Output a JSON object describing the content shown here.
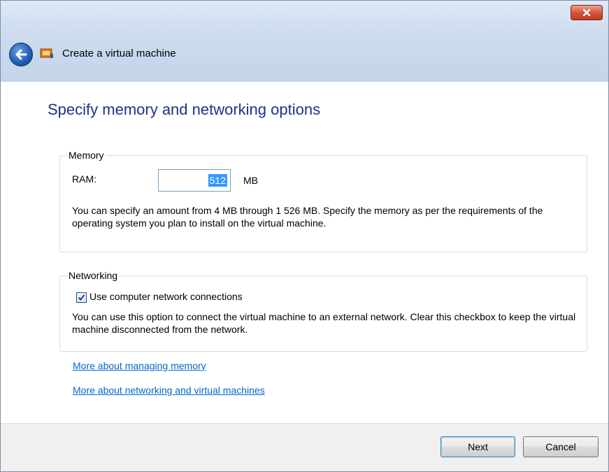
{
  "window": {
    "title": "Create a virtual machine",
    "heading": "Specify memory and networking options"
  },
  "memory": {
    "legend": "Memory",
    "ram_label": "RAM:",
    "ram_value": "512",
    "unit": "MB",
    "description": "You can specify an amount from 4 MB through 1 526 MB. Specify the memory as per the requirements of the operating system you plan to install on the virtual machine."
  },
  "networking": {
    "legend": "Networking",
    "checkbox_label": "Use computer network connections",
    "checked": true,
    "description": "You can use this option to connect the virtual machine to an external network. Clear this checkbox to keep the virtual machine disconnected from the network."
  },
  "links": {
    "memory": "More about managing memory",
    "networking": "More about networking and virtual machines"
  },
  "buttons": {
    "next": "Next",
    "cancel": "Cancel"
  },
  "icons": {
    "back": "back-arrow-icon",
    "app": "virtual-pc-icon",
    "close": "close-icon",
    "check": "checkmark-icon"
  },
  "colors": {
    "heading": "#1e3287",
    "link": "#0066cc",
    "selection": "#3399ff",
    "close_button": "#d5573b"
  }
}
